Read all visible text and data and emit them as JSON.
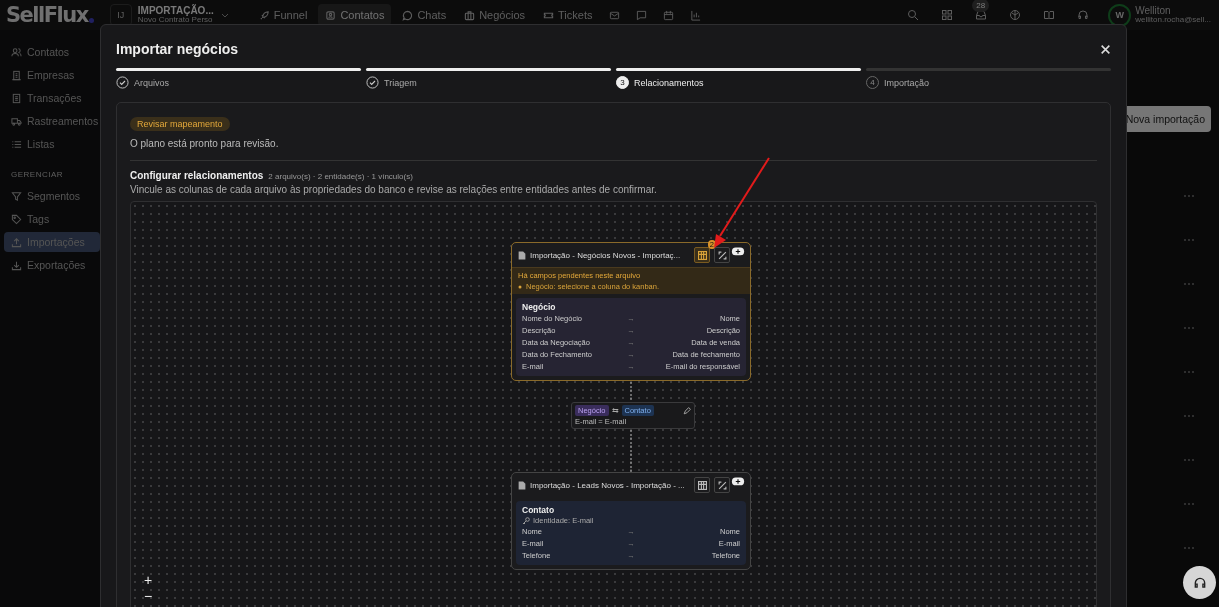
{
  "topbar": {
    "logo": "SellFlux",
    "workspace": {
      "initials": "IJ",
      "name": "IMPORTAÇÃO...",
      "subtitle": "Novo Contrato Perso"
    },
    "nav": [
      {
        "label": "Funnel",
        "selected": false
      },
      {
        "label": "Contatos",
        "selected": true
      },
      {
        "label": "Chats",
        "selected": false
      },
      {
        "label": "Negócios",
        "selected": false
      },
      {
        "label": "Tickets",
        "selected": false
      }
    ],
    "inbox_count": "28",
    "user": {
      "initial": "W",
      "name": "Welliton",
      "email": "welliton.rocha@sell..."
    }
  },
  "sidebar": {
    "items": [
      {
        "label": "Contatos",
        "selected": false
      },
      {
        "label": "Empresas",
        "selected": false
      },
      {
        "label": "Transações",
        "selected": false
      },
      {
        "label": "Rastreamentos",
        "selected": false
      },
      {
        "label": "Listas",
        "selected": false
      }
    ],
    "section": "GERENCIAR",
    "manage_items": [
      {
        "label": "Segmentos",
        "selected": false
      },
      {
        "label": "Tags",
        "selected": false
      },
      {
        "label": "Importações",
        "selected": true
      },
      {
        "label": "Exportações",
        "selected": false
      }
    ]
  },
  "background": {
    "button": "Nova importação"
  },
  "modal": {
    "title": "Importar negócios",
    "steps": [
      {
        "label": "Arquivos",
        "done": true,
        "selected": false
      },
      {
        "label": "Triagem",
        "done": true,
        "selected": false
      },
      {
        "label": "Relacionamentos",
        "done": false,
        "selected": true,
        "number": "3"
      },
      {
        "label": "Importação",
        "done": false,
        "selected": false,
        "number": "4"
      }
    ],
    "badge": "Revisar mapeamento",
    "status": "O plano está pronto para revisão.",
    "section": {
      "title": "Configurar relacionamentos",
      "meta": "2 arquivo(s) · 2 entidade(s) · 1 vínculo(s)",
      "description": "Vincule as colunas de cada arquivo às propriedades do banco e revise as relações entre entidades antes de confirmar."
    },
    "nodes": [
      {
        "title": "Importação - Negócios Novos - Importaç...",
        "warning_count": "2",
        "warning_title": "Há campos pendentes neste arquivo",
        "warnings": [
          "Negócio: selecione a coluna do kanban."
        ],
        "entity": {
          "name": "Negócio",
          "kind": "deal",
          "rows": [
            {
              "source": "Nome do Negócio",
              "arrow": "→",
              "target": "Nome"
            },
            {
              "source": "Descrição",
              "arrow": "→",
              "target": "Descrição"
            },
            {
              "source": "Data da Negociação",
              "arrow": "→",
              "target": "Data de venda"
            },
            {
              "source": "Data do Fechamento",
              "arrow": "→",
              "target": "Data de fechamento"
            },
            {
              "source": "E-mail",
              "arrow": "→",
              "target": "E-mail do responsável"
            }
          ]
        }
      },
      {
        "title": "Importação - Leads Novos - Importação - ...",
        "entity": {
          "name": "Contato",
          "kind": "contact",
          "identity": "Identidade: E-mail",
          "rows": [
            {
              "source": "Nome",
              "arrow": "→",
              "target": "Nome"
            },
            {
              "source": "E-mail",
              "arrow": "→",
              "target": "E-mail"
            },
            {
              "source": "Telefone",
              "arrow": "→",
              "target": "Telefone"
            }
          ]
        }
      }
    ],
    "edge": {
      "from": {
        "label": "Negócio",
        "kind": "deal"
      },
      "symbol": "⇆",
      "to": {
        "label": "Contato",
        "kind": "contact"
      },
      "rule": "E-mail = E-mail"
    },
    "zoom": [
      "+",
      "−"
    ]
  }
}
